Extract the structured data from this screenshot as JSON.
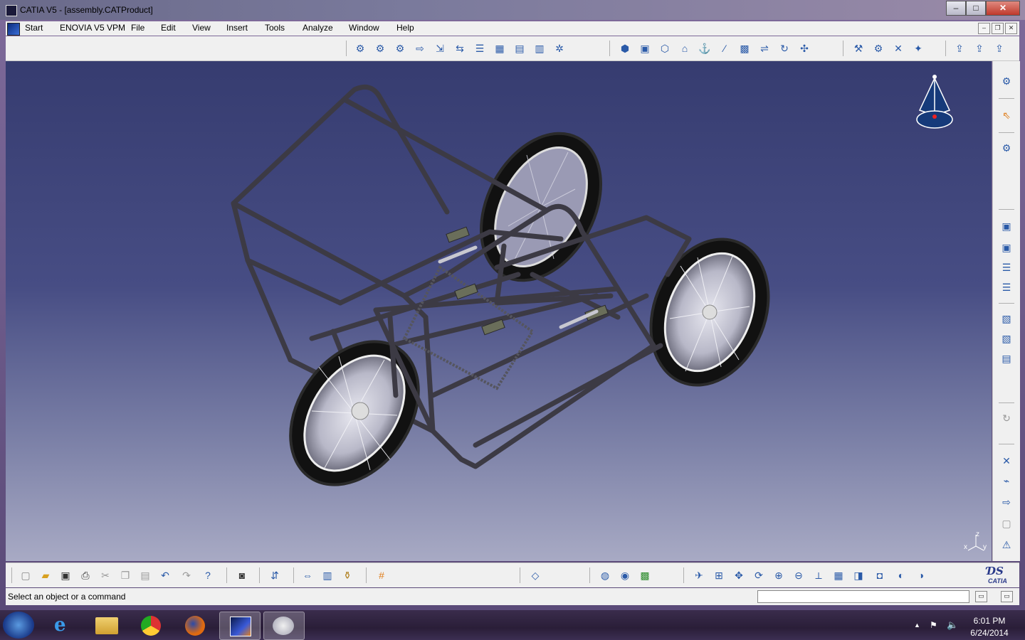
{
  "window": {
    "title": "CATIA V5 - [assembly.CATProduct]",
    "minimize": "–",
    "maximize": "□",
    "close": "✕"
  },
  "menubar": {
    "items": [
      "Start",
      "ENOVIA V5 VPM",
      "File",
      "Edit",
      "View",
      "Insert",
      "Tools",
      "Analyze",
      "Window",
      "Help"
    ]
  },
  "compass": {
    "z_label": "z",
    "x_label": "x",
    "y_label": "y"
  },
  "status": {
    "message": "Select an object or a command",
    "command_input": ""
  },
  "brand": {
    "logo_text": "CATIA"
  },
  "taskbar": {
    "time": "6:01 PM",
    "date": "6/24/2014",
    "apps": [
      "start-orb",
      "internet-explorer",
      "file-explorer",
      "chrome",
      "firefox",
      "catia",
      "paint"
    ]
  },
  "colors": {
    "viewport_top": "#363c70",
    "viewport_bottom": "#a8aac4",
    "frame_tube": "#3a3a40",
    "tire": "#141414",
    "rim": "#c8c8d4"
  }
}
